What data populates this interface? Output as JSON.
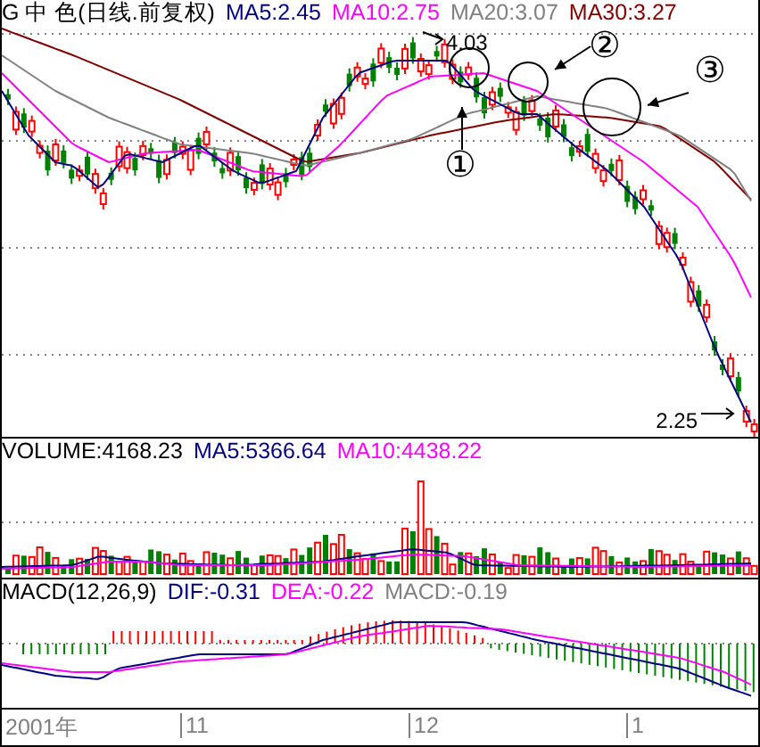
{
  "header": {
    "title": "G 中 色(日线.前复权)",
    "indicators": [
      {
        "label": "MA5:2.45",
        "color": "#000080"
      },
      {
        "label": "MA10:2.75",
        "color": "#ff00ff"
      },
      {
        "label": "MA20:3.07",
        "color": "#808080"
      },
      {
        "label": "MA30:3.27",
        "color": "#800000"
      }
    ]
  },
  "main_chart": {
    "annotations": [
      {
        "kind": "price",
        "text": "4.03"
      },
      {
        "kind": "marker",
        "text": "①"
      },
      {
        "kind": "marker",
        "text": "②"
      },
      {
        "kind": "marker",
        "text": "③"
      },
      {
        "kind": "price",
        "text": "2.25"
      }
    ]
  },
  "volume": {
    "title": "VOLUME:4168.23",
    "indicators": [
      {
        "label": "MA5:5366.64",
        "color": "#000080"
      },
      {
        "label": "MA10:4438.22",
        "color": "#ff00ff"
      }
    ]
  },
  "macd": {
    "title": "MACD(12,26,9)",
    "indicators": [
      {
        "label": "DIF:-0.31",
        "color": "#000080"
      },
      {
        "label": "DEA:-0.22",
        "color": "#ff00ff"
      },
      {
        "label": "MACD:-0.19",
        "color": "#808080"
      }
    ]
  },
  "x_axis": {
    "labels": [
      "2001年",
      "11",
      "12",
      "1"
    ]
  }
}
